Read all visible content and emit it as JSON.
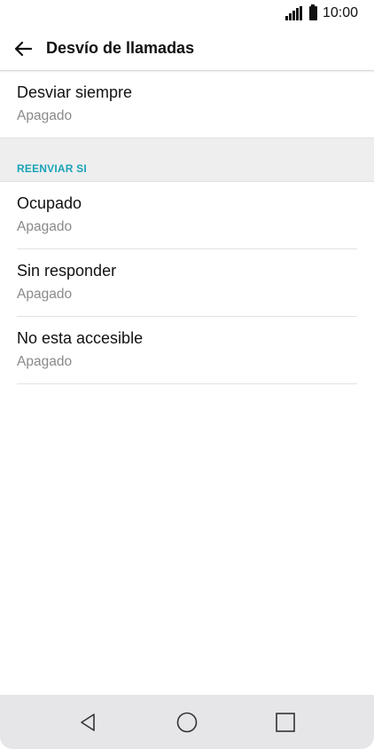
{
  "status_bar": {
    "time": "10:00",
    "icons": [
      "signal-icon",
      "battery-icon"
    ]
  },
  "app_bar": {
    "back_icon": "arrow-left-icon",
    "title": "Desvío de llamadas"
  },
  "items": [
    {
      "title": "Desviar siempre",
      "subtitle": "Apagado"
    }
  ],
  "section": {
    "label": "REENVIAR SI",
    "label_color": "#1aa3b8",
    "items": [
      {
        "title": "Ocupado",
        "subtitle": "Apagado"
      },
      {
        "title": "Sin responder",
        "subtitle": "Apagado"
      },
      {
        "title": "No esta accesible",
        "subtitle": "Apagado"
      }
    ]
  },
  "nav_bar": {
    "buttons": [
      "back-triangle-icon",
      "home-circle-icon",
      "recents-square-icon"
    ]
  }
}
